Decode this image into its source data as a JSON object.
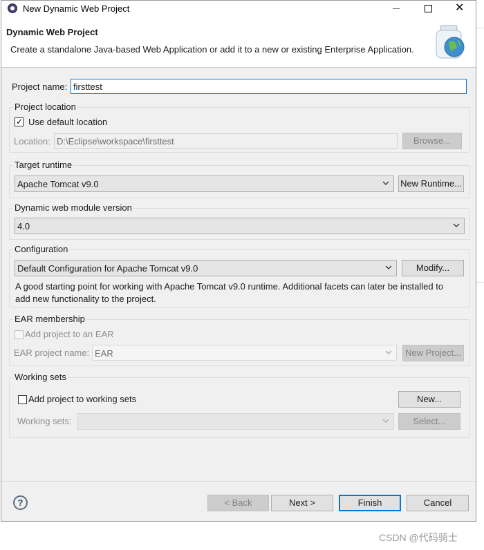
{
  "window": {
    "title": "New Dynamic Web Project",
    "minimize_label": "minimize",
    "maximize_label": "maximize",
    "close_label": "close"
  },
  "header": {
    "title": "Dynamic Web Project",
    "description": "Create a standalone Java-based Web Application or add it to a new or existing Enterprise Application."
  },
  "project_name": {
    "label": "Project name:",
    "value": "firsttest"
  },
  "project_location": {
    "group_title": "Project location",
    "use_default_label": "Use default location",
    "use_default_checked": true,
    "location_label": "Location:",
    "location_value": "D:\\Eclipse\\workspace\\firsttest",
    "browse_label": "Browse..."
  },
  "target_runtime": {
    "group_title": "Target runtime",
    "selected": "Apache Tomcat v9.0",
    "new_runtime_label": "New Runtime..."
  },
  "module_version": {
    "group_title": "Dynamic web module version",
    "selected": "4.0"
  },
  "configuration": {
    "group_title": "Configuration",
    "selected": "Default Configuration for Apache Tomcat v9.0",
    "modify_label": "Modify...",
    "description_line1": "A good starting point for working with Apache Tomcat v9.0 runtime. Additional facets can later be installed to",
    "description_line2": "add new functionality to the project."
  },
  "ear_membership": {
    "group_title": "EAR membership",
    "add_label": "Add project to an EAR",
    "add_checked": false,
    "name_label": "EAR project name:",
    "name_value": "EAR",
    "new_project_label": "New Project..."
  },
  "working_sets": {
    "group_title": "Working sets",
    "add_label": "Add project to working sets",
    "add_checked": false,
    "new_label": "New...",
    "sets_label": "Working sets:",
    "select_label": "Select..."
  },
  "footer": {
    "help_glyph": "?",
    "back_label": "< Back",
    "next_label": "Next >",
    "finish_label": "Finish",
    "cancel_label": "Cancel"
  },
  "watermark": "CSDN @代码骑士",
  "colors": {
    "window_bg": "#f0f0f0",
    "focus_accent": "#0078d7",
    "button_bg": "#e1e1e1"
  },
  "icons": {
    "app": "eclipse-icon",
    "wizard": "jar-globe-icon",
    "help": "help-icon",
    "dropdown": "chevron-down-icon"
  }
}
